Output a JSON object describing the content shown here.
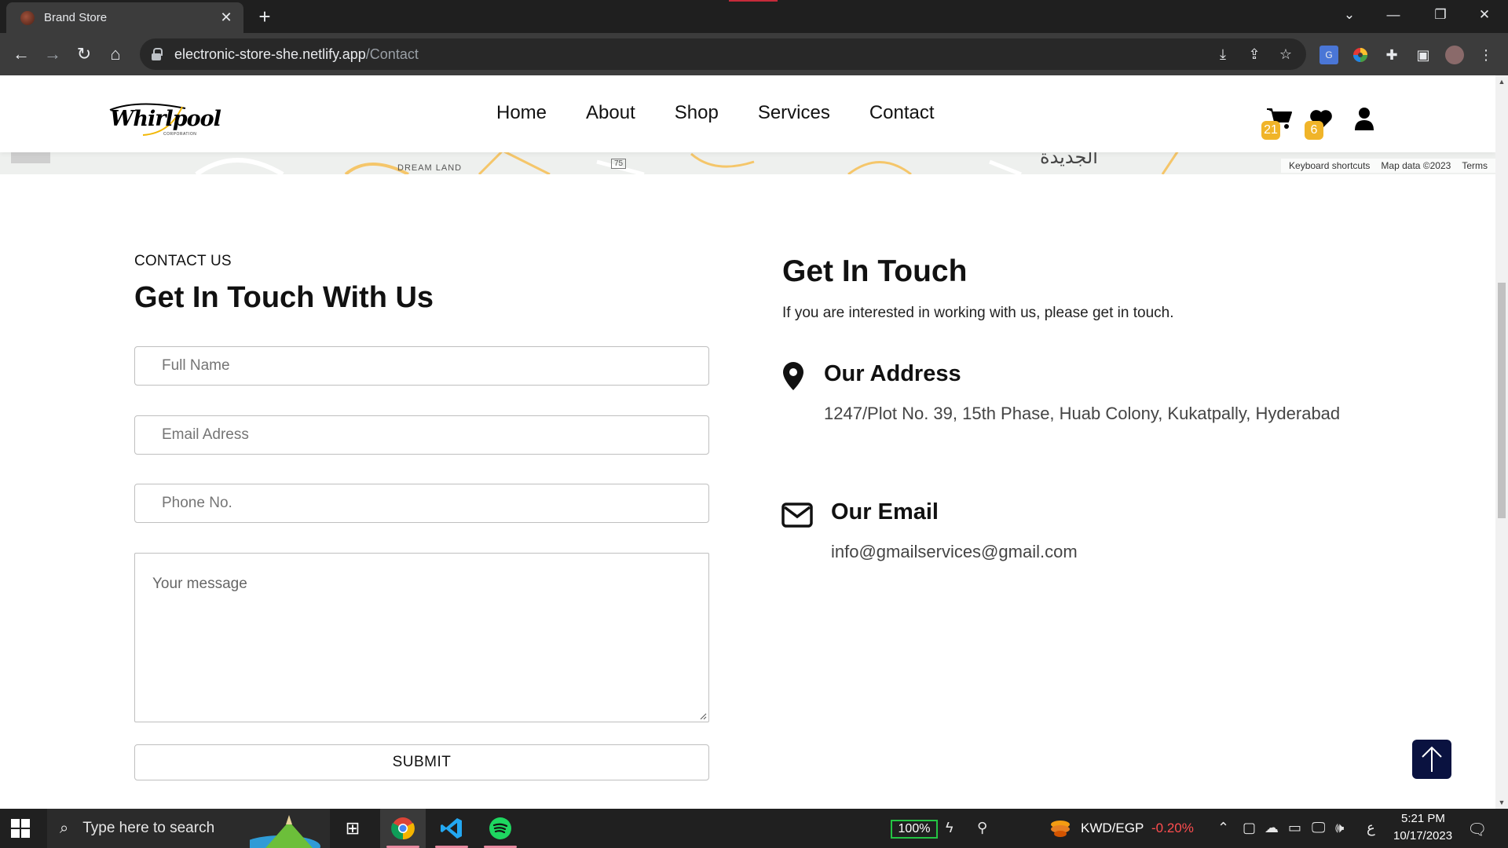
{
  "browser": {
    "tab_title": "Brand Store",
    "url_host": "electronic-store-she.netlify.app",
    "url_path": "/Contact",
    "new_tab_symbol": "+",
    "close_symbol": "✕"
  },
  "map": {
    "place_label": "DREAM LAND",
    "route_number": "75",
    "arabic_label": "الجديدة",
    "footer": [
      "Keyboard shortcuts",
      "Map data ©2023",
      "Terms"
    ]
  },
  "header": {
    "logo_text": "Whirlpool",
    "logo_sub": "CORPORATION",
    "nav": [
      "Home",
      "About",
      "Shop",
      "Services",
      "Contact"
    ],
    "cart_count": "21",
    "wishlist_count": "6"
  },
  "contact_form": {
    "eyebrow": "CONTACT US",
    "title": "Get In Touch With Us",
    "full_name_placeholder": "Full Name",
    "email_placeholder": "Email Adress",
    "phone_placeholder": "Phone No.",
    "message_placeholder": "Your message",
    "submit_label": "SUBMIT"
  },
  "contact_info": {
    "title": "Get In Touch",
    "intro": "If you are interested in working with us, please get in touch.",
    "address_heading": "Our Address",
    "address_text": "1247/Plot No. 39, 15th Phase, Huab Colony, Kukatpally, Hyderabad",
    "email_heading": "Our Email",
    "email_text": "info@gmailservices@gmail.com"
  },
  "taskbar": {
    "search_placeholder": "Type here to search",
    "battery": "100%",
    "currency_pair": "KWD/EGP",
    "currency_change": "-0.20%",
    "ime_indicator": "ع",
    "time": "5:21 PM",
    "date": "10/17/2023"
  },
  "colors": {
    "badge": "#f0b429",
    "to_top": "#0a1240",
    "currency_down": "#ff4d4f",
    "battery_border": "#24c443"
  }
}
